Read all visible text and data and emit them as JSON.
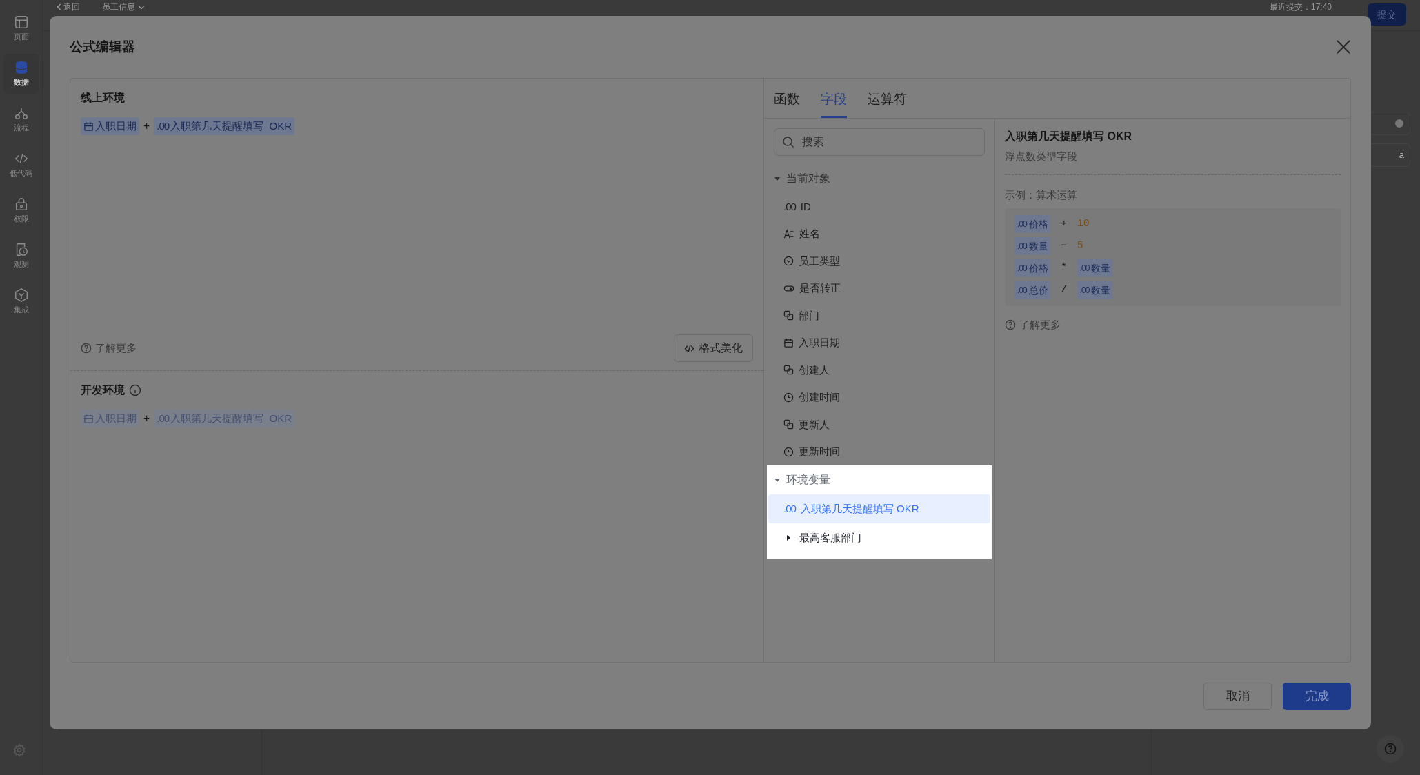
{
  "app_sidebar": {
    "items": [
      {
        "label": "页面",
        "selected": false
      },
      {
        "label": "数据",
        "selected": true
      },
      {
        "label": "流程",
        "selected": false
      },
      {
        "label": "低代码",
        "selected": false
      },
      {
        "label": "权限",
        "selected": false
      },
      {
        "label": "观测",
        "selected": false
      },
      {
        "label": "集成",
        "selected": false
      }
    ]
  },
  "top_bar": {
    "back": "返回",
    "breadcrumb": "员工信息",
    "last_commit": "最近提交：17:40",
    "submit": "提交"
  },
  "background_fields": [
    {
      "kind": "icon"
    },
    {
      "kind": "text",
      "value": "a"
    }
  ],
  "dialog": {
    "title": "公式编辑器",
    "editors": [
      {
        "label": "线上环境",
        "info": false,
        "disabled": false,
        "tokens": [
          {
            "kind": "date",
            "text": "入职日期"
          },
          {
            "kind": "operator",
            "text": "+"
          },
          {
            "kind": "number",
            "prefix": ".00",
            "text": "入职第几天提醒填写  OKR"
          }
        ]
      },
      {
        "label": "开发环境",
        "info": true,
        "disabled": true,
        "tokens": [
          {
            "kind": "date",
            "text": "入职日期"
          },
          {
            "kind": "operator",
            "text": "+"
          },
          {
            "kind": "number",
            "prefix": ".00",
            "text": "入职第几天提醒填写  OKR"
          }
        ]
      }
    ],
    "learn_more": "了解更多",
    "format_button": "格式美化",
    "tabs": [
      {
        "label": "函数",
        "selected": false
      },
      {
        "label": "字段",
        "selected": true
      },
      {
        "label": "运算符",
        "selected": false
      }
    ],
    "search": {
      "placeholder": "搜索"
    },
    "tree": [
      {
        "label": "当前对象",
        "expanded": true,
        "spotlight": false,
        "children": [
          {
            "kind": "number",
            "prefix": ".00",
            "label": "ID",
            "selected": false
          },
          {
            "kind": "text",
            "label": "姓名",
            "selected": false
          },
          {
            "kind": "select",
            "label": "员工类型",
            "selected": false
          },
          {
            "kind": "toggle",
            "label": "是否转正",
            "selected": false
          },
          {
            "kind": "relation",
            "label": "部门",
            "selected": false
          },
          {
            "kind": "date",
            "label": "入职日期",
            "selected": false
          },
          {
            "kind": "relation",
            "label": "创建人",
            "selected": false
          },
          {
            "kind": "time",
            "label": "创建时间",
            "selected": false
          },
          {
            "kind": "relation",
            "label": "更新人",
            "selected": false
          },
          {
            "kind": "time",
            "label": "更新时间",
            "selected": false
          }
        ]
      },
      {
        "label": "环境变量",
        "expanded": true,
        "spotlight": true,
        "children": [
          {
            "kind": "number",
            "prefix": ".00",
            "label": "入职第几天提醒填写 OKR",
            "selected": true
          },
          {
            "kind": "group",
            "label": "最高客服部门",
            "expanded": false,
            "selected": false
          }
        ]
      }
    ],
    "detail": {
      "title": "入职第几天提醒填写 OKR",
      "subtitle": "浮点数类型字段",
      "example_label": "示例：算术运算",
      "examples": [
        [
          {
            "kind": "field",
            "prefix": ".00",
            "text": "价格"
          },
          {
            "kind": "operator",
            "text": "+"
          },
          {
            "kind": "literal",
            "text": "10"
          }
        ],
        [
          {
            "kind": "field",
            "prefix": ".00",
            "text": "数量"
          },
          {
            "kind": "operator",
            "text": "−"
          },
          {
            "kind": "literal",
            "text": "5"
          }
        ],
        [
          {
            "kind": "field",
            "prefix": ".00",
            "text": "价格"
          },
          {
            "kind": "operator",
            "text": "*"
          },
          {
            "kind": "field",
            "prefix": ".00",
            "text": "数量"
          }
        ],
        [
          {
            "kind": "field",
            "prefix": ".00",
            "text": "总价"
          },
          {
            "kind": "operator",
            "text": "/"
          },
          {
            "kind": "field",
            "prefix": ".00",
            "text": "数量"
          }
        ]
      ],
      "learn_more": "了解更多"
    },
    "buttons": [
      {
        "kind": "secondary",
        "label": "取消"
      },
      {
        "kind": "primary",
        "label": "完成"
      }
    ]
  }
}
